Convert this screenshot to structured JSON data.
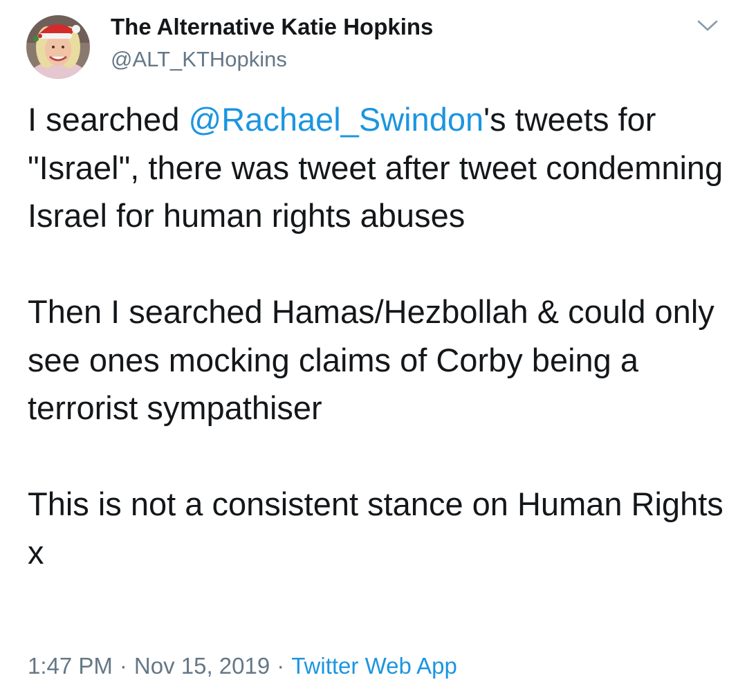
{
  "tweet": {
    "author": {
      "display_name": "The Alternative Katie Hopkins",
      "handle": "@ALT_KTHopkins"
    },
    "menu_icon": "chevron-down-icon",
    "paragraphs": [
      {
        "before": "I searched ",
        "mention": "@Rachael_Swindon",
        "after": "'s tweets for \"Israel\", there was tweet after tweet condemning Israel for human rights abuses"
      },
      {
        "text": "Then I searched Hamas/Hezbollah & could only see ones mocking claims of Corby being a terrorist sympathiser"
      },
      {
        "text": "This is not a consistent stance on Human Rights x"
      }
    ],
    "time": "1:47 PM",
    "date": "Nov 15, 2019",
    "separator": "·",
    "source": "Twitter Web App"
  },
  "colors": {
    "text": "#14171a",
    "secondary": "#657786",
    "link": "#1b95e0",
    "background": "#ffffff"
  }
}
